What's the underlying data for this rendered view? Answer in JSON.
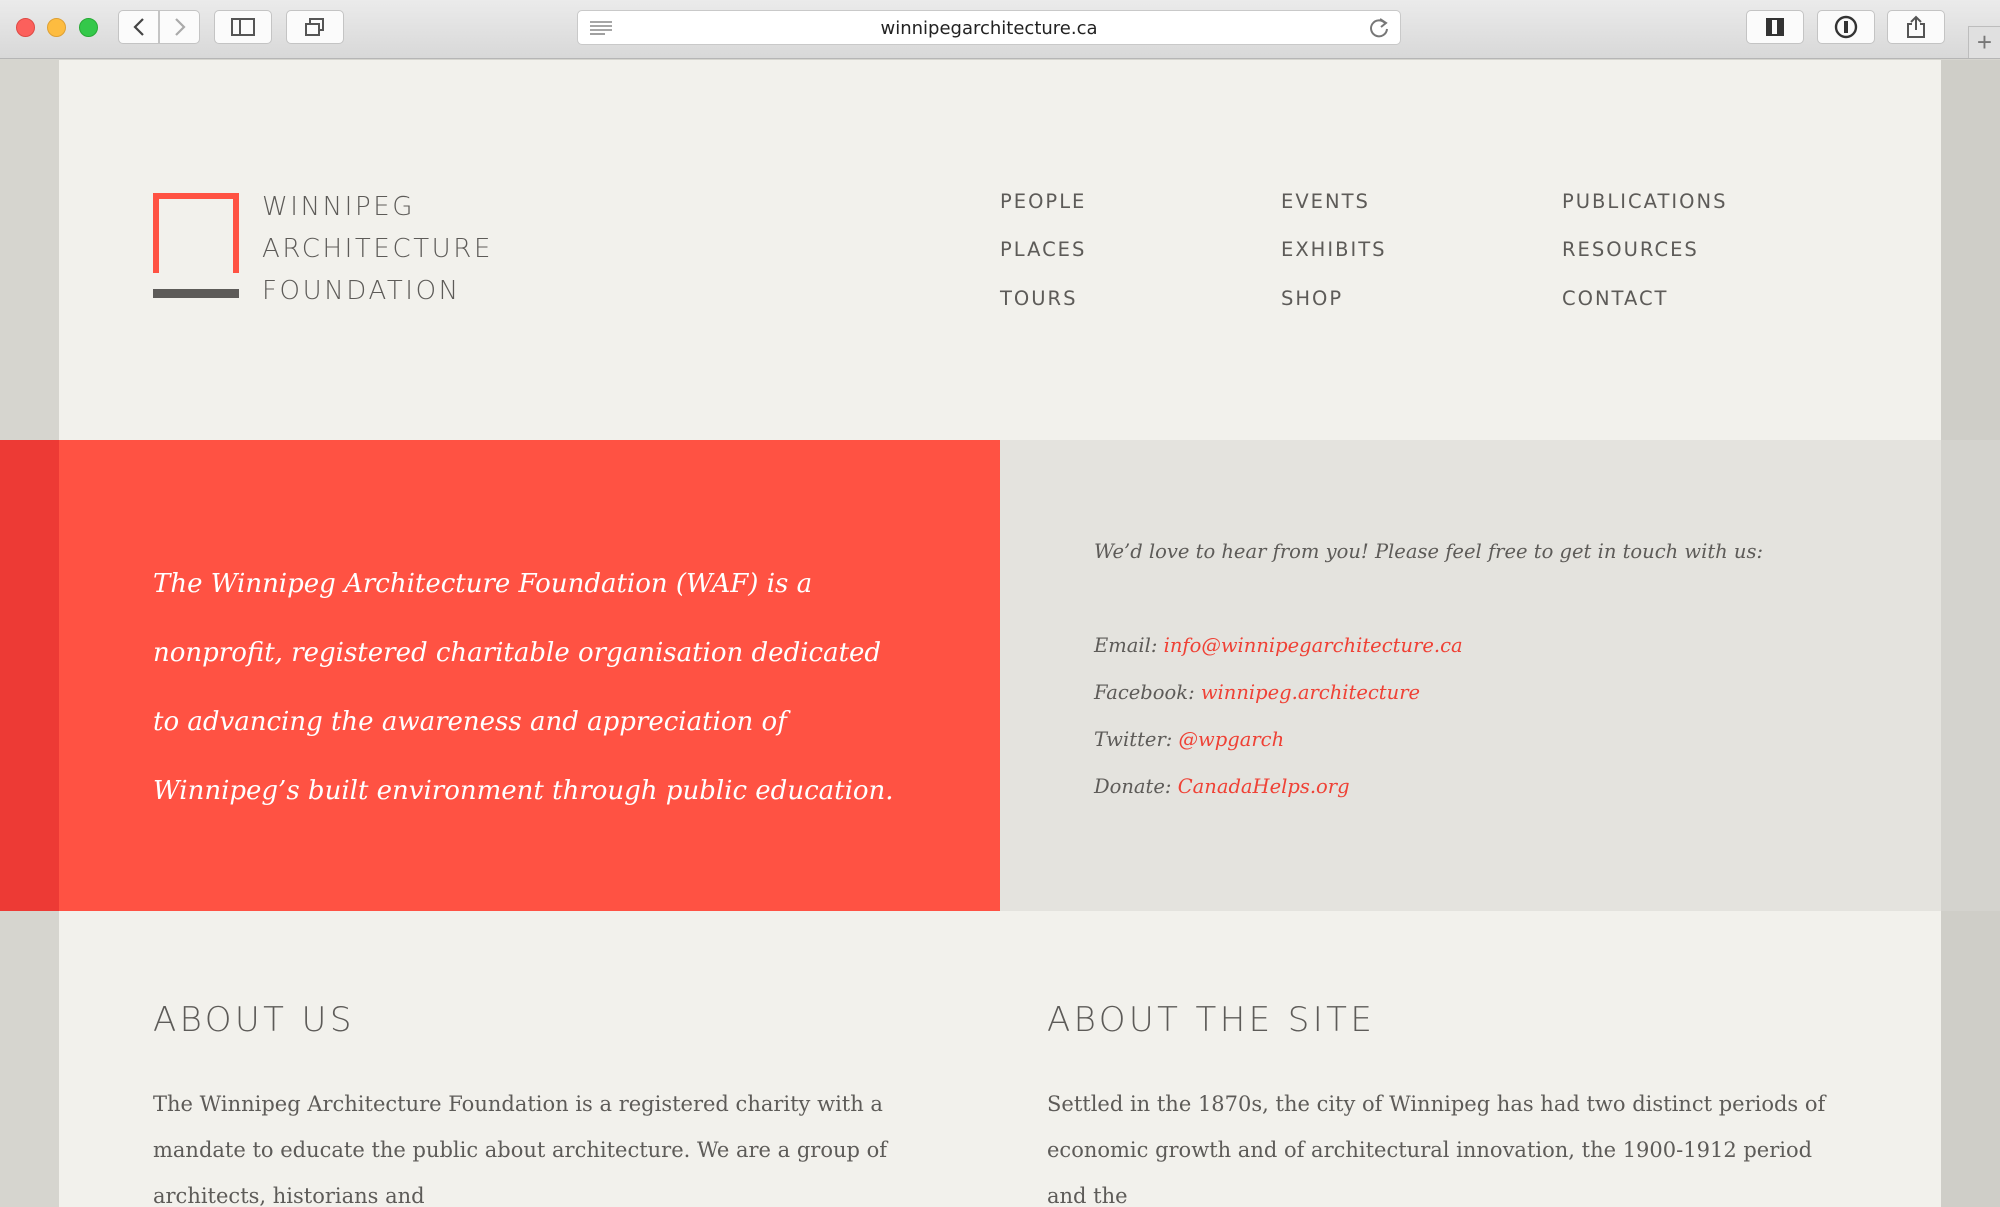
{
  "browser": {
    "url": "winnipegarchitecture.ca",
    "buttons": {
      "back": "back-icon",
      "forward": "forward-icon",
      "sidebar": "sidebar-icon",
      "tabs": "tabs-overview-icon",
      "reader": "reader-icon",
      "reload": "reload-icon",
      "bookmark": "bookmark-icon",
      "password": "password-manager-icon",
      "share": "share-icon",
      "new_tab": "+"
    }
  },
  "logo": {
    "lines": [
      "WINNIPEG",
      "ARCHITECTURE",
      "FOUNDATION"
    ]
  },
  "nav": {
    "col1": [
      "PEOPLE",
      "PLACES",
      "TOURS"
    ],
    "col2": [
      "EVENTS",
      "EXHIBITS",
      "SHOP"
    ],
    "col3": [
      "PUBLICATIONS",
      "RESOURCES",
      "CONTACT"
    ]
  },
  "mission": "The Winnipeg Architecture Foundation (WAF) is a nonprofit, registered charitable organisation dedicated to advancing the awareness and appreciation of Winnipeg’s built environment through public education.",
  "contact": {
    "intro": "We’d love to hear from you! Please feel free to get in touch with us:",
    "rows": [
      {
        "label": "Email:",
        "value": "info@winnipegarchitecture.ca"
      },
      {
        "label": "Facebook:",
        "value": "winnipeg.architecture"
      },
      {
        "label": "Twitter:",
        "value": "@wpgarch"
      },
      {
        "label": "Donate:",
        "value": "CanadaHelps.org"
      }
    ]
  },
  "about_us": {
    "heading": "ABOUT US",
    "text": "The Winnipeg Architecture Foundation is a registered charity with a mandate to educate the public about architecture. We are a group of architects, historians and"
  },
  "about_site": {
    "heading": "ABOUT THE SITE",
    "text": "Settled in the 1870s, the city of Winnipeg has had two distinct periods of economic growth and of architectural innovation, the 1900-1912 period and the"
  },
  "colors": {
    "accent_red": "#ff5243",
    "link_red": "#ef4135",
    "text_grey": "#5d5b58",
    "background": "#f2f1ec"
  }
}
